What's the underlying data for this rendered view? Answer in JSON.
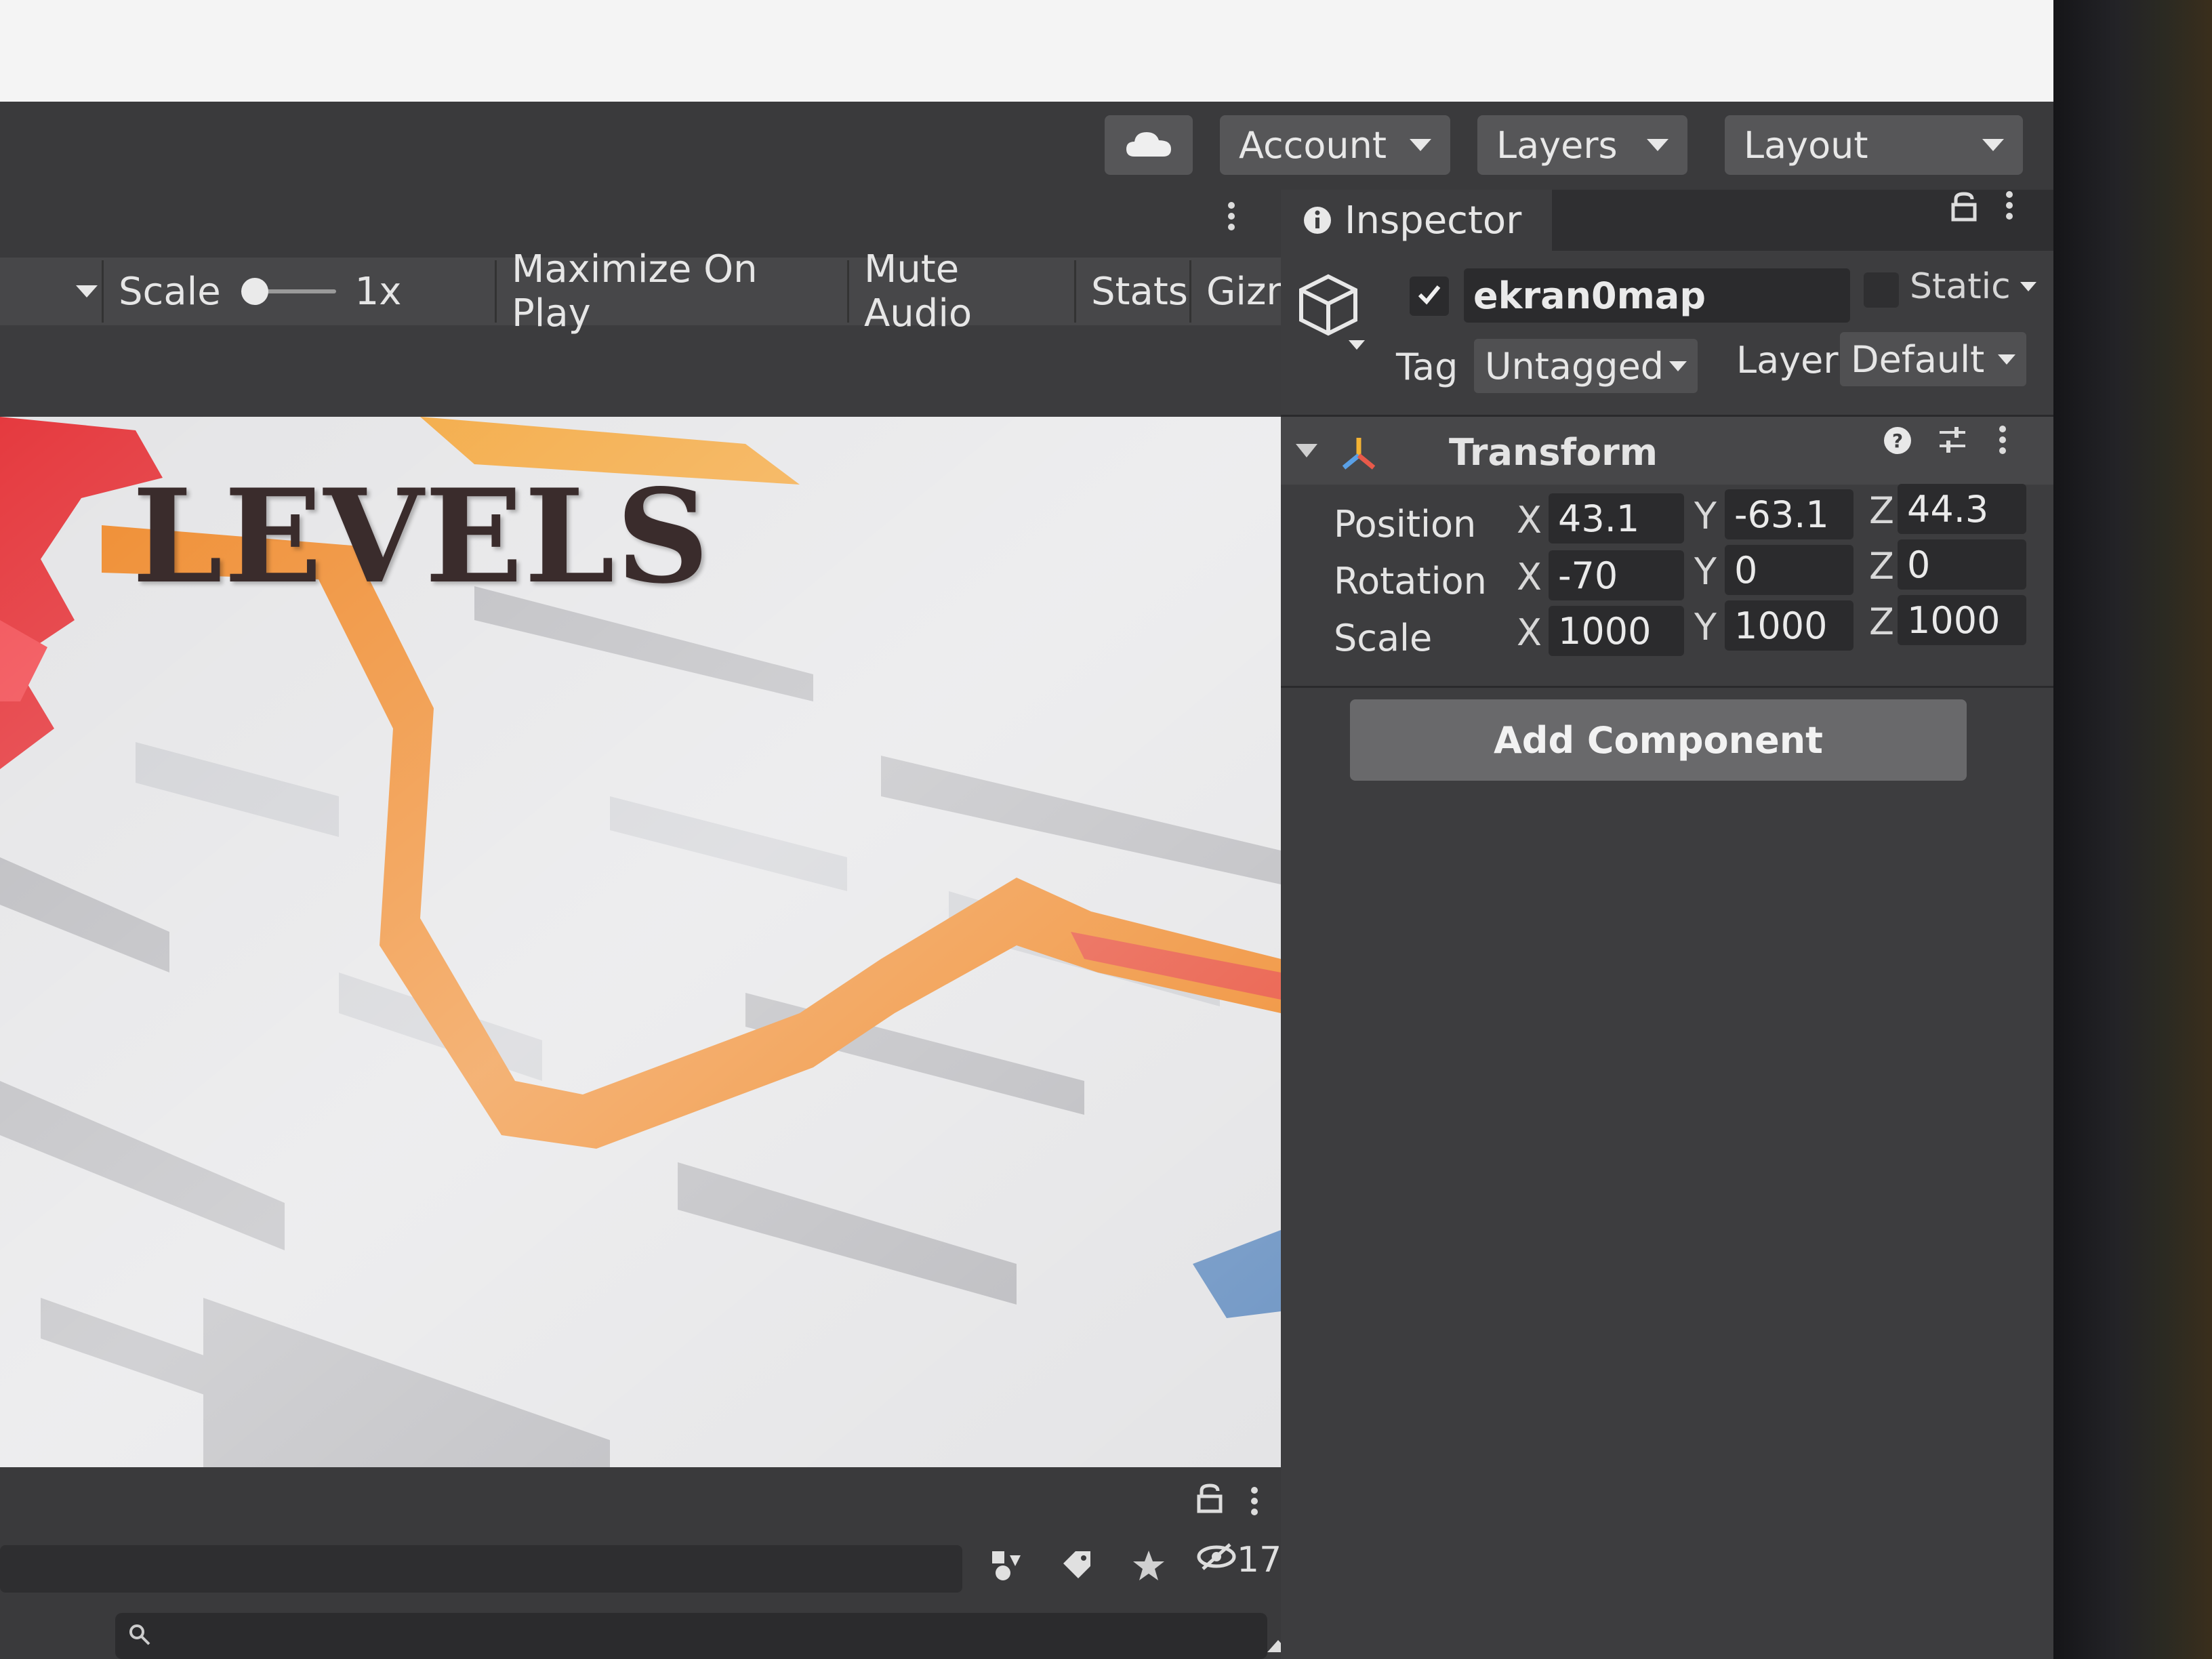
{
  "toolbar": {
    "account_label": "Account",
    "layers_label": "Layers",
    "layout_label": "Layout"
  },
  "game_view": {
    "scale_label": "Scale",
    "scale_value": "1x",
    "maximize_label": "Maximize On Play",
    "mute_label": "Mute Audio",
    "stats_label": "Stats",
    "gizmos_label": "Gizn",
    "scene_title": "LEVELS"
  },
  "inspector": {
    "tab_label": "Inspector",
    "object_name": "ekran0map",
    "active_checked": true,
    "static_label": "Static",
    "tag_label": "Tag",
    "tag_value": "Untagged",
    "layer_label": "Layer",
    "layer_value": "Default",
    "transform": {
      "title": "Transform",
      "position_label": "Position",
      "rotation_label": "Rotation",
      "scale_label": "Scale",
      "position": {
        "x": "43.1",
        "y": "-63.1",
        "z": "44.3"
      },
      "rotation": {
        "x": "-70",
        "y": "0",
        "z": "0"
      },
      "scale": {
        "x": "1000",
        "y": "1000",
        "z": "1000"
      }
    },
    "add_component_label": "Add Component"
  },
  "bottom_panel": {
    "hidden_count": "17"
  },
  "axes": {
    "x": "X",
    "y": "Y",
    "z": "Z"
  },
  "colors": {
    "panel": "#3d3d3f",
    "field": "#2b2b2d",
    "maze_red": "#e8363a",
    "maze_orange": "#f29a2e",
    "maze_white": "#f2f2f2"
  }
}
